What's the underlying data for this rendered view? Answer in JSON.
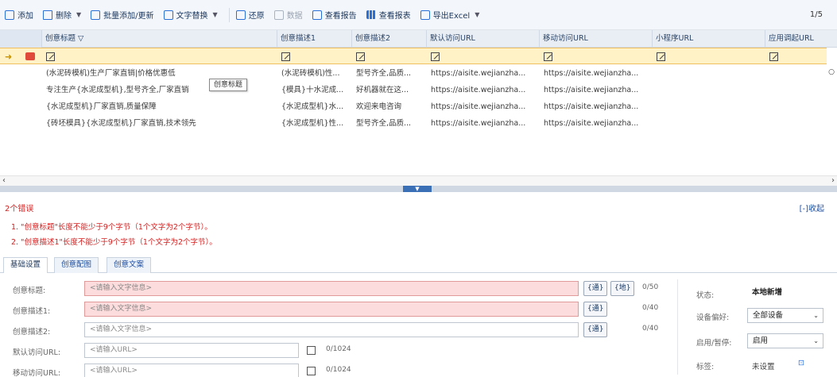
{
  "toolbar": {
    "add": "添加",
    "delete": "删除",
    "batch": "批量添加/更新",
    "text_replace": "文字替换",
    "restore": "还原",
    "stats": "数据",
    "report": "查看报告",
    "auto": "查看报表",
    "export": "导出Excel",
    "pager": "1/5"
  },
  "grid": {
    "columns": [
      "创意标题",
      "创意描述1",
      "创意描述2",
      "默认访问URL",
      "移动访问URL",
      "小程序URL",
      "应用调起URL"
    ],
    "tooltip": "创意标题",
    "rows": [
      [
        "(水泥砖模机)生产厂家直销|价格优惠低",
        "(水泥砖模机)性...",
        "型号齐全,品质...",
        "https://aisite.wejianzha...",
        "https://aisite.wejianzha..."
      ],
      [
        "专注生产{水泥成型机},型号齐全,厂家直销",
        "{模具}十水泥成...",
        "好机器就在这...",
        "https://aisite.wejianzha...",
        "https://aisite.wejianzha..."
      ],
      [
        "{水泥成型机}厂家直销,质量保障",
        "{水泥成型机}水...",
        "欢迎来电咨询",
        "https://aisite.wejianzha...",
        "https://aisite.wejianzha..."
      ],
      [
        "{砖坯模具}{水泥成型机}厂家直销,技术领先",
        "{水泥成型机}性...",
        "型号齐全,品质...",
        "https://aisite.wejianzha...",
        "https://aisite.wejianzha..."
      ]
    ]
  },
  "errors": {
    "title": "2个错误",
    "collapse": "[-]收起",
    "lines": [
      "1. \"创意标题\"长度不能少于9个字节（1个文字为2个字节）。",
      "2. \"创意描述1\"长度不能少于9个字节（1个文字为2个字节）。"
    ]
  },
  "tabs": [
    "基础设置",
    "创意配图",
    "创意文案"
  ],
  "form": {
    "title_label": "创意标题:",
    "desc1_label": "创意描述1:",
    "desc2_label": "创意描述2:",
    "default_url_label": "默认访问URL:",
    "mobile_url_label": "移动访问URL:",
    "text_placeholder": "<请输入文字信息>",
    "url_placeholder": "<请输入URL>",
    "wildcard_btn": "{通}",
    "wildcard_btn2": "{地}",
    "count_title": "0/50",
    "count_desc1": "0/40",
    "count_desc2": "0/40",
    "count_url1": "0/1024",
    "count_url2": "0/1024"
  },
  "side": {
    "status_label": "状态:",
    "status_value": "本地新增",
    "device_label": "设备偏好:",
    "device_value": "全部设备",
    "enable_label": "启用/暂停:",
    "enable_value": "启用",
    "tag_label": "标签:",
    "tag_value": "未设置"
  }
}
